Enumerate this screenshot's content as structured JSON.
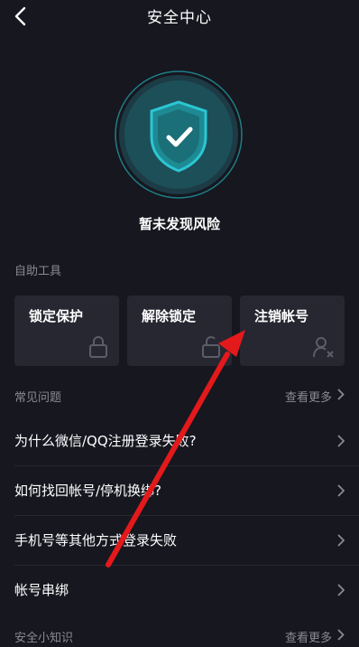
{
  "header": {
    "title": "安全中心"
  },
  "status": {
    "text": "暂未发现风险"
  },
  "tools": {
    "section_label": "自助工具",
    "items": [
      {
        "label": "锁定保护",
        "icon": "lock-icon"
      },
      {
        "label": "解除锁定",
        "icon": "unlock-icon"
      },
      {
        "label": "注销帐号",
        "icon": "remove-user-icon"
      }
    ]
  },
  "faq": {
    "section_label": "常见问题",
    "see_more": "查看更多",
    "items": [
      {
        "text": "为什么微信/QQ注册登录失败?"
      },
      {
        "text": "如何找回帐号/停机换绑?"
      },
      {
        "text": "手机号等其他方式登录失败"
      },
      {
        "text": "帐号串绑"
      }
    ]
  },
  "tips": {
    "section_label": "安全小知识",
    "see_more": "查看更多"
  },
  "colors": {
    "background": "#16171f",
    "card": "#262731",
    "shield_teal": "#1e8a93",
    "shield_ring": "#2bc7d3",
    "muted_text": "#8a8b92",
    "annotation": "#e3191b"
  },
  "icons": [
    "back-arrow-icon",
    "shield-check-icon",
    "lock-icon",
    "unlock-icon",
    "remove-user-icon",
    "chevron-right-icon"
  ]
}
